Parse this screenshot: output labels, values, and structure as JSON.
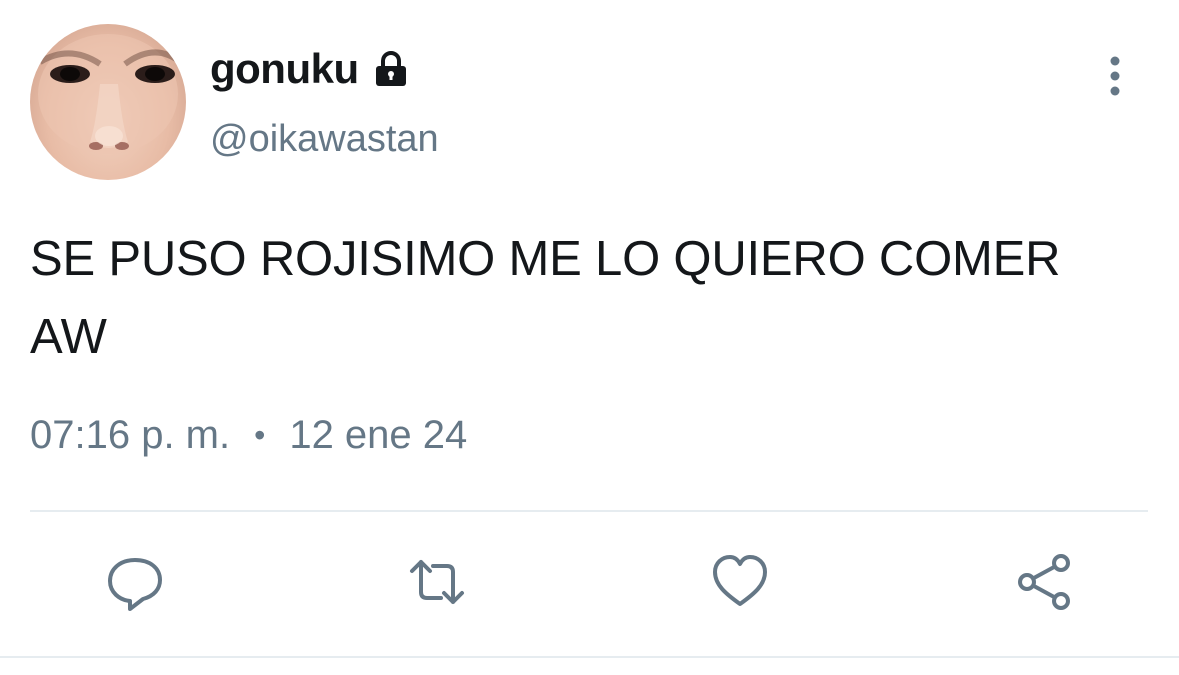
{
  "tweet": {
    "display_name": "gonuku",
    "handle": "@oikawastan",
    "text": "SE PUSO ROJISIMO ME LO QUIERO COMER AW",
    "time": "07:16 p. m.",
    "separator": "•",
    "date": "12 ene 24"
  },
  "icons": {
    "lock": "lock-icon",
    "more": "more-vertical-icon",
    "reply": "reply-icon",
    "retweet": "retweet-icon",
    "like": "heart-icon",
    "share": "share-icon"
  },
  "colors": {
    "text": "#14171a",
    "secondary": "#657786",
    "divider": "#e6ecf0"
  }
}
